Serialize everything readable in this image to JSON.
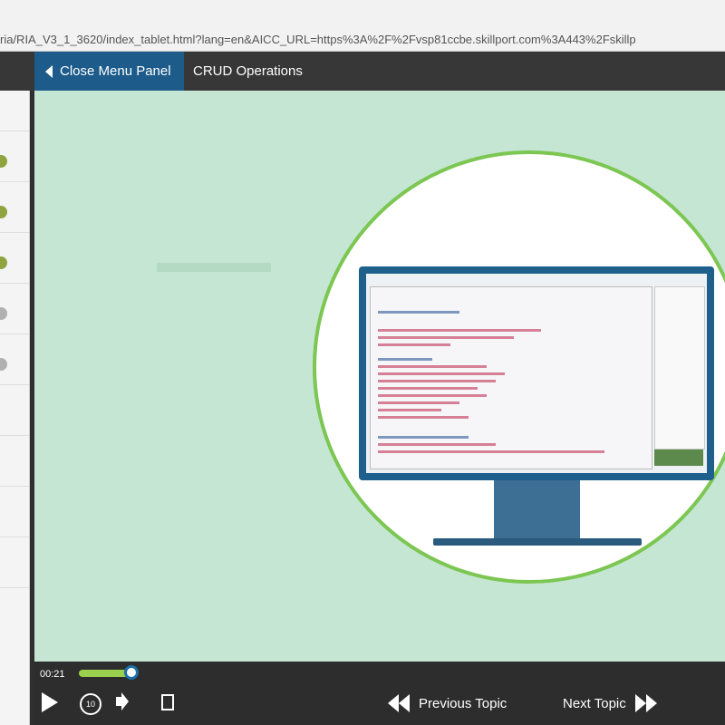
{
  "browser": {
    "url": "ria/RIA_V3_1_3620/index_tablet.html?lang=en&AICC_URL=https%3A%2F%2Fvsp81ccbe.skillport.com%3A443%2Fskillp"
  },
  "header": {
    "close_menu_label": "Close Menu Panel",
    "topic_title": "CRUD Operations"
  },
  "player": {
    "time": "00:21",
    "progress_fraction": 0.08,
    "replay_label": "10",
    "previous_label": "Previous Topic",
    "next_label": "Next Topic"
  },
  "stage_icons": [
    "monitor-icon",
    "code-editor-illustration"
  ],
  "colors": {
    "header_bg": "#373737",
    "close_button_bg": "#1c5b8a",
    "stage_bg": "#c5e6d3",
    "circle_border": "#7cc652",
    "progress_fill": "#9bd04f"
  }
}
